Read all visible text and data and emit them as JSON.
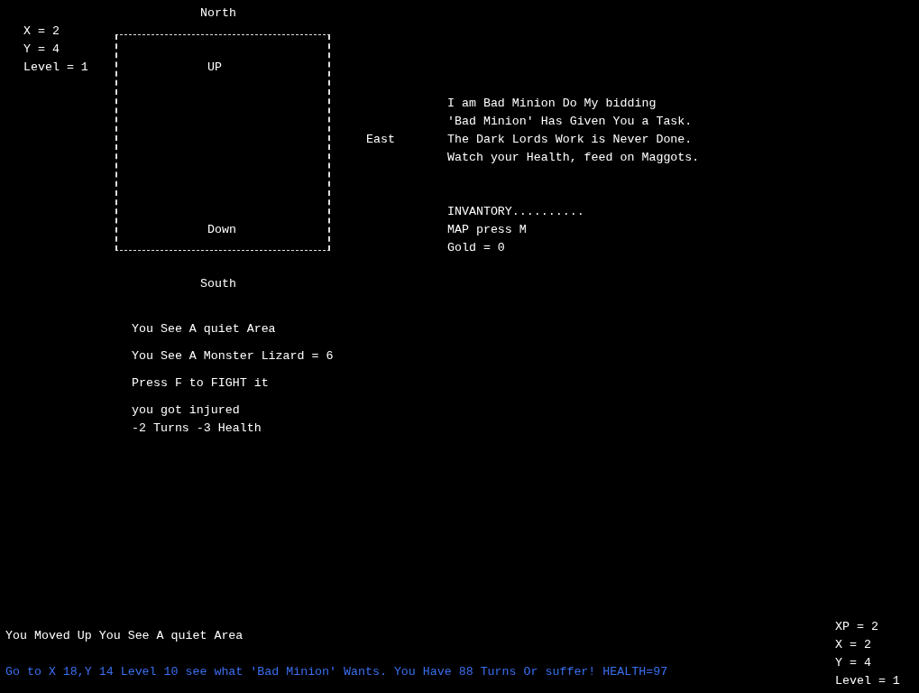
{
  "compass": {
    "north": "North",
    "south": "South",
    "east": "East"
  },
  "room": {
    "up": "UP",
    "down": "Down"
  },
  "position": [
    "X = 2",
    "Y = 4",
    "Level = 1"
  ],
  "messages": [
    "I am Bad Minion Do My bidding",
    "'Bad Minion' Has Given You a Task.",
    "The Dark Lords Work is Never Done.",
    "Watch your Health, feed on Maggots."
  ],
  "inventory": [
    "INVANTORY..........",
    "MAP press M",
    "Gold = 0"
  ],
  "events": [
    [
      "You See A quiet Area"
    ],
    [
      "You See A Monster Lizard = 6"
    ],
    [
      "Press F to FIGHT it"
    ],
    [
      "you got injured",
      "-2 Turns -3 Health"
    ]
  ],
  "status_line": "You Moved Up You See A quiet Area",
  "quest_line": "Go to X 18,Y 14 Level 10 see what 'Bad Minion' Wants. You Have 88 Turns Or suffer! HEALTH=97",
  "stats": [
    "XP = 2",
    "X = 2",
    "Y = 4",
    "Level = 1"
  ]
}
